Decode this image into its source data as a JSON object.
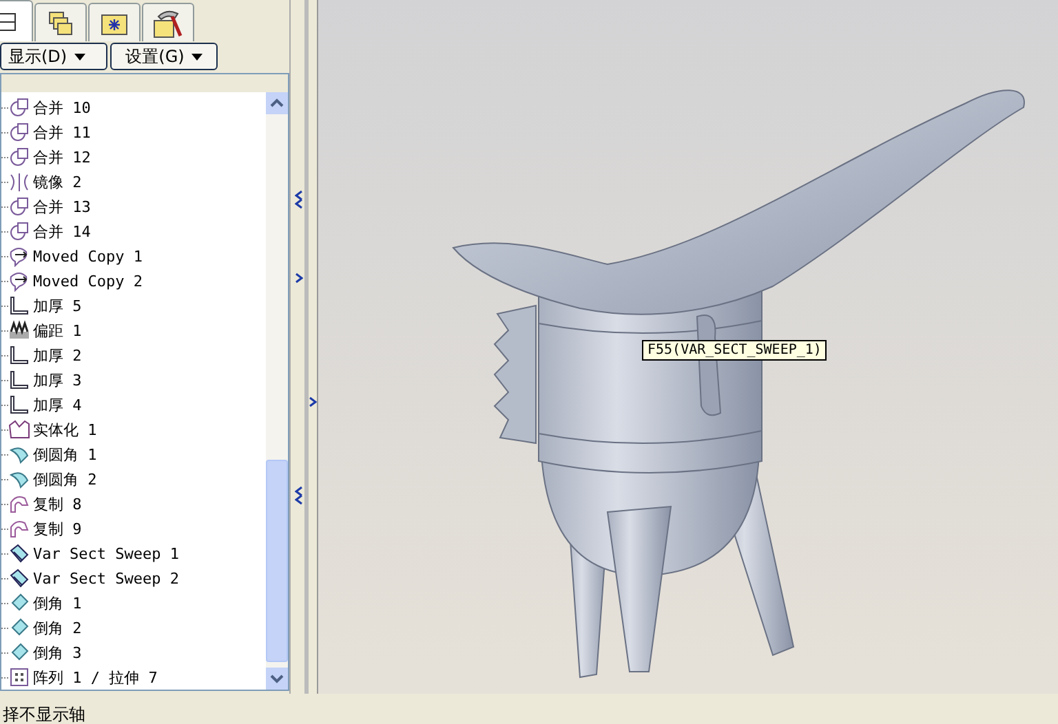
{
  "tabs": [
    {
      "kind": "tree",
      "selected": true
    },
    {
      "kind": "layers",
      "selected": false
    },
    {
      "kind": "folder-star",
      "selected": false
    },
    {
      "kind": "tools",
      "selected": false
    }
  ],
  "toolbar": {
    "buttons": [
      {
        "label": "显示(D)"
      },
      {
        "label": "设置(G)"
      }
    ]
  },
  "tree": {
    "items": [
      {
        "label": "合并 10",
        "kind": "merge"
      },
      {
        "label": "合并 11",
        "kind": "merge"
      },
      {
        "label": "合并 12",
        "kind": "merge"
      },
      {
        "label": "镜像 2",
        "kind": "mirror"
      },
      {
        "label": "合并 13",
        "kind": "merge"
      },
      {
        "label": "合并 14",
        "kind": "merge"
      },
      {
        "label": "Moved Copy 1",
        "kind": "moved-copy"
      },
      {
        "label": "Moved Copy 2",
        "kind": "moved-copy"
      },
      {
        "label": "加厚 5",
        "kind": "thicken"
      },
      {
        "label": "偏距 1",
        "kind": "offset"
      },
      {
        "label": "加厚 2",
        "kind": "thicken"
      },
      {
        "label": "加厚 3",
        "kind": "thicken"
      },
      {
        "label": "加厚 4",
        "kind": "thicken"
      },
      {
        "label": "实体化 1",
        "kind": "solidify"
      },
      {
        "label": "倒圆角 1",
        "kind": "round"
      },
      {
        "label": "倒圆角 2",
        "kind": "round"
      },
      {
        "label": "复制 8",
        "kind": "copy"
      },
      {
        "label": "复制 9",
        "kind": "copy"
      },
      {
        "label": "Var Sect Sweep 1",
        "kind": "sweep"
      },
      {
        "label": "Var Sect Sweep 2",
        "kind": "sweep"
      },
      {
        "label": "倒角 1",
        "kind": "chamfer"
      },
      {
        "label": "倒角 2",
        "kind": "chamfer"
      },
      {
        "label": "倒角 3",
        "kind": "chamfer"
      },
      {
        "label": "阵列 1 / 拉伸 7",
        "kind": "pattern"
      }
    ]
  },
  "tooltip": "F55(VAR_SECT_SWEEP_1)",
  "status_bar": {
    "text": "择不显示轴"
  }
}
